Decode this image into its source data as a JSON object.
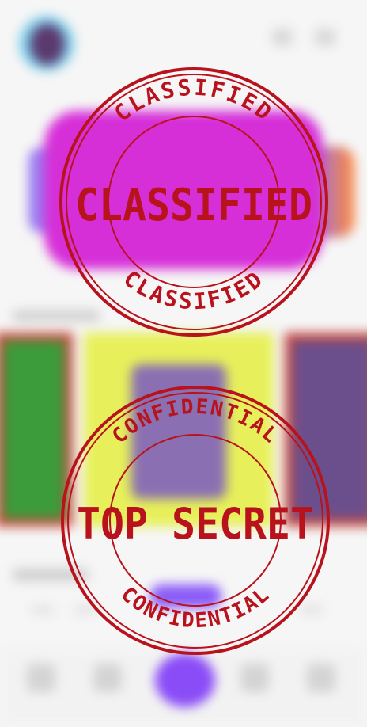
{
  "stamps": {
    "top": {
      "ring_text": "CLASSIFIED",
      "center_text": "CLASSIFIED"
    },
    "bottom": {
      "ring_text": "CONFIDENTIAL",
      "center_text": "TOP SECRET"
    }
  },
  "colors": {
    "stamp_red": "#b8131c",
    "banner_magenta": "#d62fd8",
    "card_lime": "#e7f05a",
    "accent_purple": "#8a4cf7"
  },
  "icons": [
    "user-avatar-icon",
    "notification-icon",
    "menu-icon",
    "home-icon",
    "search-icon",
    "add-icon",
    "library-icon",
    "profile-icon"
  ]
}
